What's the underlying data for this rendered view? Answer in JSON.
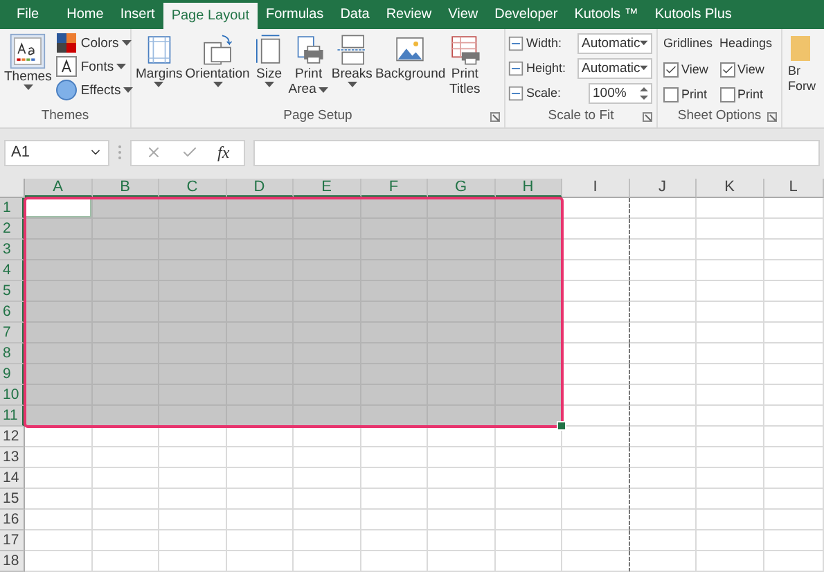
{
  "tabs": [
    {
      "label": "File",
      "selected": false
    },
    {
      "label": "Home",
      "selected": false
    },
    {
      "label": "Insert",
      "selected": false
    },
    {
      "label": "Page Layout",
      "selected": true
    },
    {
      "label": "Formulas",
      "selected": false
    },
    {
      "label": "Data",
      "selected": false
    },
    {
      "label": "Review",
      "selected": false
    },
    {
      "label": "View",
      "selected": false
    },
    {
      "label": "Developer",
      "selected": false
    },
    {
      "label": "Kutools ™",
      "selected": false
    },
    {
      "label": "Kutools Plus",
      "selected": false
    }
  ],
  "ribbon": {
    "themes": {
      "label": "Themes",
      "big_button": "Themes",
      "small_buttons": [
        {
          "label": "Colors",
          "kind": "colors"
        },
        {
          "label": "Fonts",
          "kind": "fonts"
        },
        {
          "label": "Effects",
          "kind": "effects"
        }
      ]
    },
    "page_setup": {
      "label": "Page Setup",
      "buttons": [
        {
          "lines": [
            "Margins"
          ],
          "kind": "margins",
          "dropdown": true
        },
        {
          "lines": [
            "Orientation"
          ],
          "kind": "orientation",
          "dropdown": true
        },
        {
          "lines": [
            "Size"
          ],
          "kind": "size",
          "dropdown": true
        },
        {
          "lines": [
            "Print",
            "Area"
          ],
          "kind": "print-area",
          "dropdown": true
        },
        {
          "lines": [
            "Breaks"
          ],
          "kind": "breaks",
          "dropdown": true
        },
        {
          "lines": [
            "Background"
          ],
          "kind": "background",
          "dropdown": false
        },
        {
          "lines": [
            "Print",
            "Titles"
          ],
          "kind": "print-titles",
          "dropdown": false
        }
      ]
    },
    "scale_to_fit": {
      "label": "Scale to Fit",
      "rows": [
        {
          "label": "Width:",
          "value": "Automatic",
          "kind": "dropdown"
        },
        {
          "label": "Height:",
          "value": "Automatic",
          "kind": "dropdown"
        },
        {
          "label": "Scale:",
          "value": "100%",
          "kind": "spinner"
        }
      ]
    },
    "sheet_options": {
      "label": "Sheet Options",
      "columns": [
        {
          "title": "Gridlines",
          "options": [
            {
              "label": "View",
              "checked": true
            },
            {
              "label": "Print",
              "checked": false
            }
          ]
        },
        {
          "title": "Headings",
          "options": [
            {
              "label": "View",
              "checked": true
            },
            {
              "label": "Print",
              "checked": false
            }
          ]
        }
      ]
    },
    "arrange": {
      "lines": [
        "Br",
        "Forw"
      ]
    }
  },
  "formula_bar": {
    "name_box": "A1",
    "function_button": "fx"
  },
  "columns": [
    {
      "label": "A",
      "selected": true,
      "active": true,
      "page_break": false
    },
    {
      "label": "B",
      "selected": true,
      "active": false,
      "page_break": false
    },
    {
      "label": "C",
      "selected": true,
      "active": false,
      "page_break": false
    },
    {
      "label": "D",
      "selected": true,
      "active": false,
      "page_break": false
    },
    {
      "label": "E",
      "selected": true,
      "active": false,
      "page_break": false
    },
    {
      "label": "F",
      "selected": true,
      "active": false,
      "page_break": false
    },
    {
      "label": "G",
      "selected": true,
      "active": false,
      "page_break": false
    },
    {
      "label": "H",
      "selected": true,
      "active": false,
      "page_break": false
    },
    {
      "label": "I",
      "selected": false,
      "active": false,
      "page_break": true
    },
    {
      "label": "J",
      "selected": false,
      "active": false,
      "page_break": false
    },
    {
      "label": "K",
      "selected": false,
      "active": false,
      "page_break": false
    },
    {
      "label": "L",
      "selected": false,
      "active": false,
      "page_break": false
    }
  ],
  "rows": [
    {
      "label": "1",
      "selected": true,
      "active": true
    },
    {
      "label": "2",
      "selected": true,
      "active": false
    },
    {
      "label": "3",
      "selected": true,
      "active": false
    },
    {
      "label": "4",
      "selected": true,
      "active": false
    },
    {
      "label": "5",
      "selected": true,
      "active": false
    },
    {
      "label": "6",
      "selected": true,
      "active": false
    },
    {
      "label": "7",
      "selected": true,
      "active": false
    },
    {
      "label": "8",
      "selected": true,
      "active": false
    },
    {
      "label": "9",
      "selected": true,
      "active": false
    },
    {
      "label": "10",
      "selected": true,
      "active": false
    },
    {
      "label": "11",
      "selected": true,
      "active": false
    },
    {
      "label": "12",
      "selected": false,
      "active": false
    },
    {
      "label": "13",
      "selected": false,
      "active": false
    },
    {
      "label": "14",
      "selected": false,
      "active": false
    },
    {
      "label": "15",
      "selected": false,
      "active": false
    },
    {
      "label": "16",
      "selected": false,
      "active": false
    },
    {
      "label": "17",
      "selected": false,
      "active": false
    },
    {
      "label": "18",
      "selected": false,
      "active": false
    }
  ]
}
